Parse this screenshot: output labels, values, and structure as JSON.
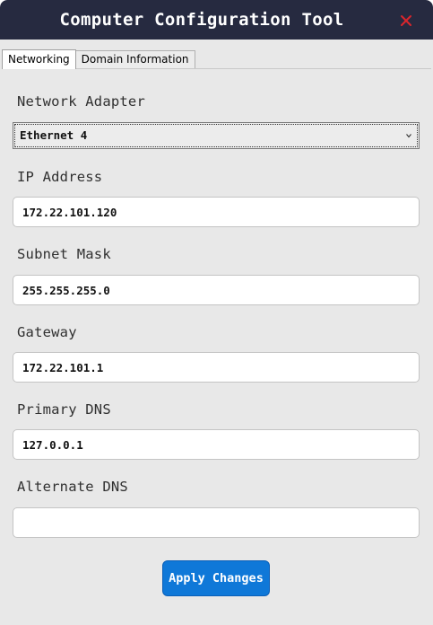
{
  "window": {
    "title": "Computer Configuration Tool"
  },
  "tabs": [
    {
      "label": "Networking",
      "active": true
    },
    {
      "label": "Domain Information",
      "active": false
    }
  ],
  "networking": {
    "adapter": {
      "label": "Network Adapter",
      "selected": "Ethernet 4"
    },
    "ip_address": {
      "label": "IP Address",
      "value": "172.22.101.120"
    },
    "subnet_mask": {
      "label": "Subnet Mask",
      "value": "255.255.255.0"
    },
    "gateway": {
      "label": "Gateway",
      "value": "172.22.101.1"
    },
    "primary_dns": {
      "label": "Primary DNS",
      "value": "127.0.0.1"
    },
    "alternate_dns": {
      "label": "Alternate DNS",
      "value": ""
    }
  },
  "actions": {
    "apply_label": "Apply Changes"
  },
  "colors": {
    "titlebar": "#262a40",
    "close_icon": "#d9262c",
    "accent_button": "#0f78d8",
    "window_background": "#e8e8e8"
  }
}
